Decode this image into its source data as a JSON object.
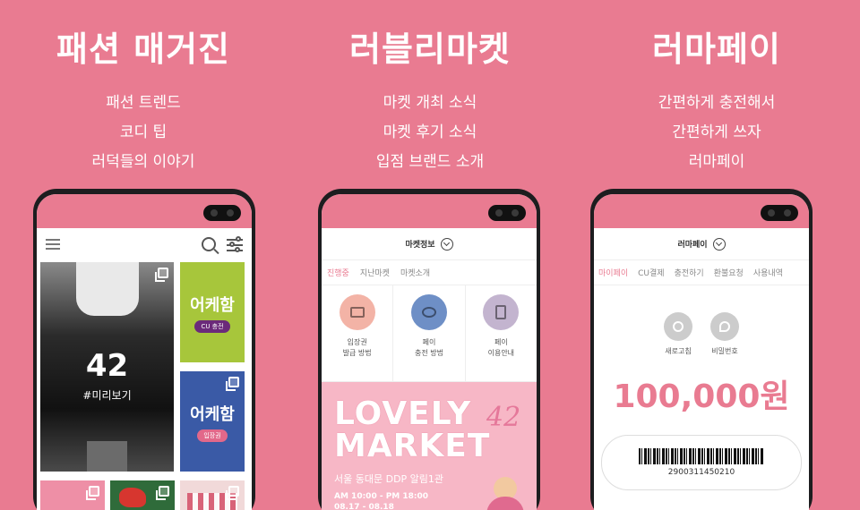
{
  "columns": [
    {
      "title": "패션 매거진",
      "lines": [
        "패션 트렌드",
        "코디 팁",
        "러덕들의 이야기"
      ]
    },
    {
      "title": "러블리마켓",
      "lines": [
        "마켓 개최 소식",
        "마켓 후기 소식",
        "입점 브랜드 소개"
      ]
    },
    {
      "title": "러마페이",
      "lines": [
        "간편하게 충전해서",
        "간편하게 쓰자",
        "러마페이"
      ]
    }
  ],
  "magazine": {
    "big_card_number": "42",
    "big_card_tag": "#미리보기",
    "side_cards": [
      {
        "title": "어케함",
        "pill": "CU 충전"
      },
      {
        "title": "어케함",
        "pill": "입장권"
      }
    ]
  },
  "market": {
    "nav_title": "마켓정보",
    "tabs": [
      "진행중",
      "지난마켓",
      "마켓소개"
    ],
    "services": [
      {
        "line1": "입장권",
        "line2": "발급 방법",
        "icon": "ticket-icon",
        "color": "#F3B3A6"
      },
      {
        "line1": "페이",
        "line2": "충전 방법",
        "icon": "piggy-bank-icon",
        "color": "#6E8FC6"
      },
      {
        "line1": "페이",
        "line2": "이용안내",
        "icon": "receipt-icon",
        "color": "#C3B4CF"
      }
    ],
    "banner": {
      "line1": "LOVELY",
      "line2": "MARKET",
      "number": "42",
      "venue": "서울 동대문 DDP 알림1관",
      "time": "AM 10:00 - PM 18:00",
      "dates": "08.17 - 08.18"
    }
  },
  "pay": {
    "nav_title": "러마페이",
    "tabs": [
      "마이페이",
      "CU결제",
      "충전하기",
      "환불요청",
      "사용내역"
    ],
    "actions": [
      {
        "label": "새로고침",
        "icon": "refresh-icon"
      },
      {
        "label": "비밀번호",
        "icon": "key-icon"
      }
    ],
    "balance": "100,000원",
    "barcode_number": "2900311450210"
  }
}
